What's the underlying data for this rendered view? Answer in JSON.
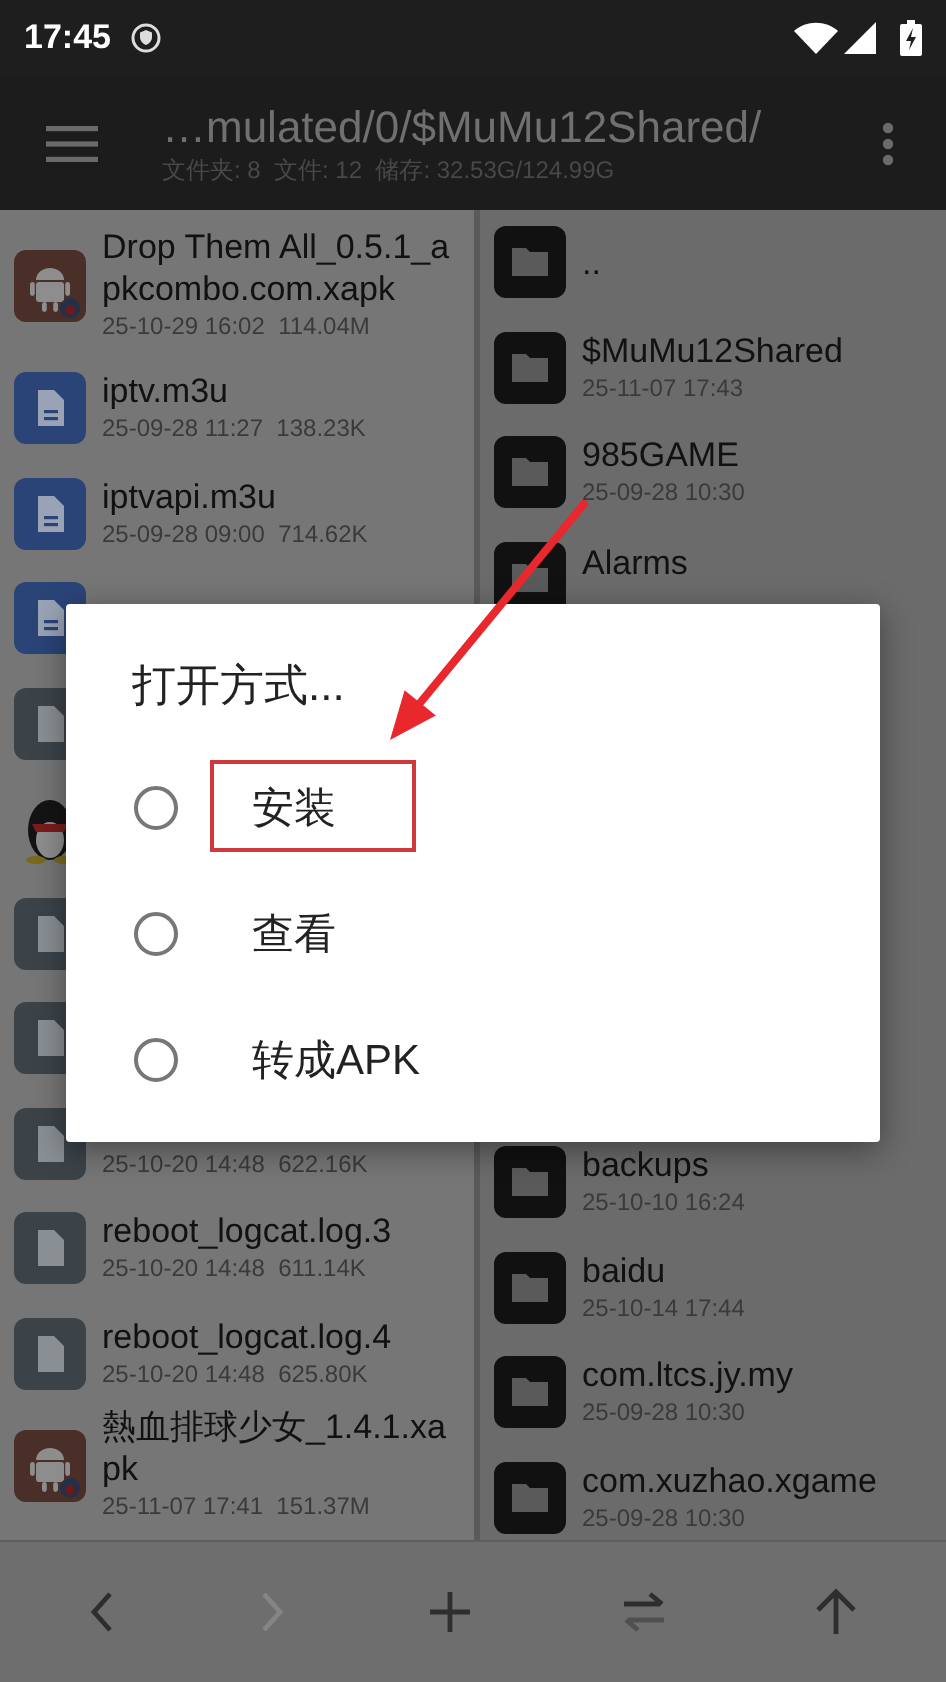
{
  "status_bar": {
    "time": "17:45"
  },
  "toolbar": {
    "title": "…mulated/0/$MuMu12Shared/",
    "subtitle": "文件夹: 8  文件: 12  储存: 32.53G/124.99G"
  },
  "left_pane": {
    "items": [
      {
        "kind": "apk",
        "name": "Drop Them All_0.5.1_apkcombo.com.xapk",
        "meta": "25-10-29 16:02  114.04M"
      },
      {
        "kind": "doc-blue",
        "name": "iptv.m3u",
        "meta": "25-09-28 11:27  138.23K"
      },
      {
        "kind": "doc-blue",
        "name": "iptvapi.m3u",
        "meta": "25-09-28 09:00  714.62K"
      },
      {
        "kind": "doc-blue"
      },
      {
        "kind": "doc-grey"
      },
      {
        "kind": "penguin"
      },
      {
        "kind": "doc-grey"
      },
      {
        "kind": "doc-grey"
      },
      {
        "kind": "doc-grey",
        "meta": "25-10-20 14:48  622.16K"
      },
      {
        "kind": "doc-grey",
        "name": "reboot_logcat.log.3",
        "meta": "25-10-20 14:48  611.14K"
      },
      {
        "kind": "doc-grey",
        "name": "reboot_logcat.log.4",
        "meta": "25-10-20 14:48  625.80K"
      },
      {
        "kind": "apk",
        "name": "熱血排球少女_1.4.1.xapk",
        "meta": "25-11-07 17:41  151.37M"
      }
    ]
  },
  "right_pane": {
    "items_above": [
      {
        "kind": "folder",
        "name": ".."
      },
      {
        "kind": "folder",
        "name": "$MuMu12Shared",
        "meta": "25-11-07 17:43"
      },
      {
        "kind": "folder",
        "name": "985GAME",
        "meta": "25-09-28 10:30"
      },
      {
        "kind": "folder",
        "name": "Alarms"
      }
    ],
    "items_below": [
      {
        "kind": "folder",
        "name": "backups",
        "meta": "25-10-10 16:24"
      },
      {
        "kind": "folder",
        "name": "baidu",
        "meta": "25-10-14 17:44"
      },
      {
        "kind": "folder",
        "name": "com.ltcs.jy.my",
        "meta": "25-09-28 10:30"
      },
      {
        "kind": "folder",
        "name": "com.xuzhao.xgame",
        "meta": "25-09-28 10:30"
      }
    ]
  },
  "bottom_bar": [
    {
      "kind": "back",
      "disabled": false
    },
    {
      "kind": "forward",
      "disabled": true
    },
    {
      "kind": "add",
      "disabled": false
    },
    {
      "kind": "swap",
      "disabled": false
    },
    {
      "kind": "up",
      "disabled": false
    }
  ],
  "dialog": {
    "title": "打开方式...",
    "options": [
      {
        "label": "安装",
        "selected": false,
        "highlighted": true
      },
      {
        "label": "查看",
        "selected": false,
        "highlighted": false
      },
      {
        "label": "转成APK",
        "selected": false,
        "highlighted": false
      }
    ]
  }
}
